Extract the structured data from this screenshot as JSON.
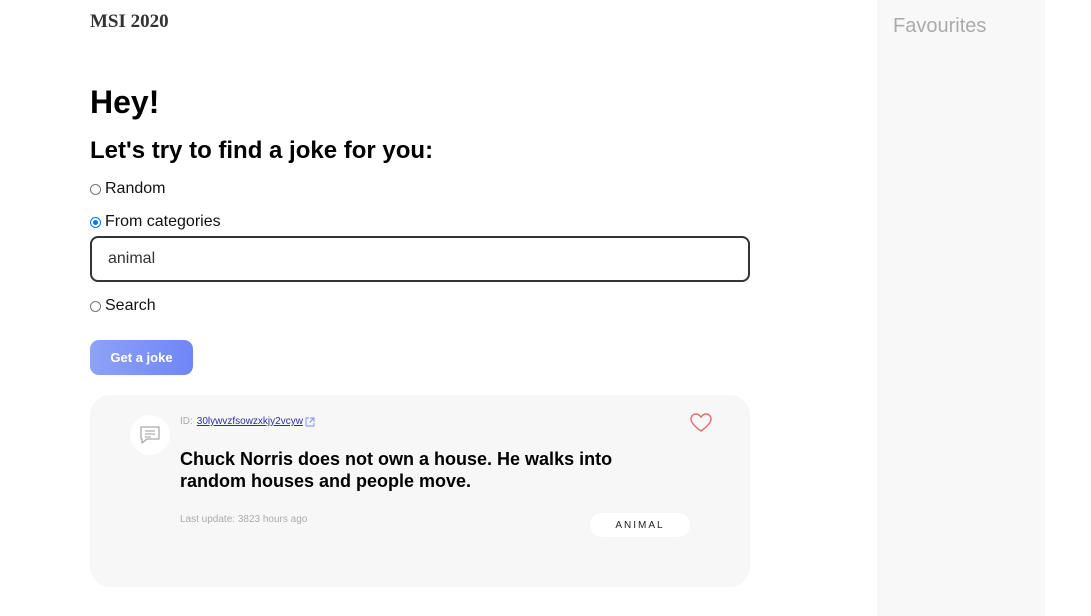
{
  "brand": "MSI 2020",
  "greeting": "Hey!",
  "subtitle": "Let's try to find a joke for you:",
  "options": {
    "random": "Random",
    "categories": "From categories",
    "search": "Search"
  },
  "selected_option": "categories",
  "category_input": {
    "value": "animal"
  },
  "get_joke_label": "Get a joke",
  "joke": {
    "id_label": "ID:",
    "id": "30lywvzfsowzxkjy2vcyw",
    "text": "Chuck Norris does not own a house. He walks into random houses and people move.",
    "last_update": "Last update: 3823 hours ago",
    "category": "ANIMAL"
  },
  "favourites_title": "Favourites",
  "colors": {
    "accent": "#7b8ff7",
    "radio_checked": "#0075ff",
    "heart": "#e26b6b",
    "card_bg": "#f7f7f7",
    "panel_bg": "#f8f8f8"
  },
  "icons": {
    "message": "message-bubble-icon",
    "external": "external-link-icon",
    "favorite": "heart-outline-icon"
  }
}
